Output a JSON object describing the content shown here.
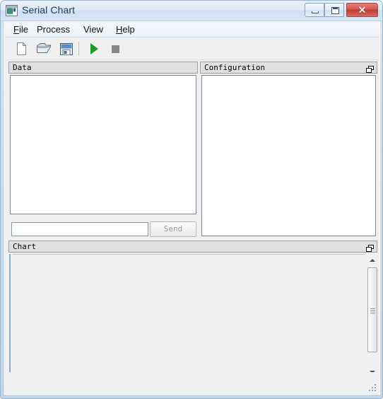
{
  "window": {
    "title": "Serial Chart",
    "app_icon": "chart-window-icon",
    "controls": {
      "minimize_label": "–",
      "maximize_label": "□",
      "close_label": "✕"
    }
  },
  "menubar": {
    "items": [
      {
        "label": "File",
        "accel": "F",
        "rest": "ile"
      },
      {
        "label": "Process",
        "accel": "",
        "rest": "Process"
      },
      {
        "label": "View",
        "accel": "",
        "rest": "View"
      },
      {
        "label": "Help",
        "accel": "H",
        "rest": "elp"
      }
    ]
  },
  "toolbar": {
    "buttons": [
      {
        "name": "new-file-icon",
        "tooltip": "New"
      },
      {
        "name": "open-folder-icon",
        "tooltip": "Open"
      },
      {
        "name": "save-floppy-icon",
        "tooltip": "Save"
      },
      {
        "name": "play-start-icon",
        "tooltip": "Start"
      },
      {
        "name": "stop-square-icon",
        "tooltip": "Stop"
      }
    ]
  },
  "panels": {
    "data": {
      "caption": "Data",
      "list_items": [],
      "input_value": "",
      "input_placeholder": "",
      "send_label": "Send",
      "send_enabled": false
    },
    "configuration": {
      "caption": "Configuration",
      "float_icon": "restore-window-icon",
      "content": ""
    },
    "chart": {
      "caption": "Chart",
      "float_icon": "restore-window-icon",
      "content": ""
    }
  },
  "scrollbars": {
    "vertical": {
      "up_icon": "caret-up-icon",
      "down_icon": "caret-down-icon"
    },
    "horizontal": {
      "left_icon": "caret-left-icon",
      "right_icon": "caret-right-icon"
    }
  },
  "colors": {
    "title_text": "#1c3c62",
    "close_button": "#bf3a31",
    "play_green": "#1a9c27",
    "stop_gray": "#878787",
    "panel_caption_bg": "#e0e0e0",
    "client_bg": "#f0f0f0"
  },
  "status": {
    "resize_grip": "resize-grip-icon"
  }
}
